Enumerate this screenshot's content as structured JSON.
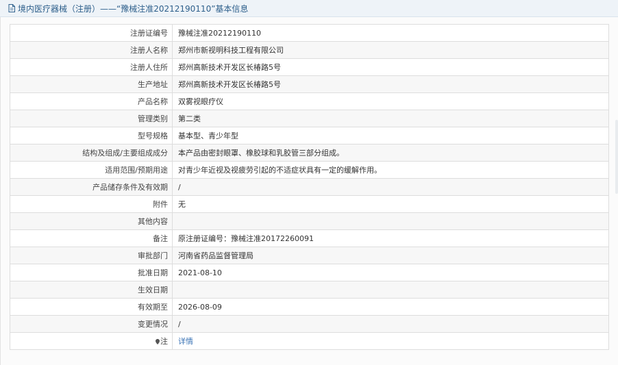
{
  "header": {
    "icon": "document-icon",
    "title": "境内医疗器械（注册）——“豫械注准20212190110”基本信息"
  },
  "rows": [
    {
      "label": "注册证编号",
      "value": "豫械注准20212190110"
    },
    {
      "label": "注册人名称",
      "value": "郑州市新视明科技工程有限公司"
    },
    {
      "label": "注册人住所",
      "value": "郑州高新技术开发区长椿路5号"
    },
    {
      "label": "生产地址",
      "value": "郑州高新技术开发区长椿路5号"
    },
    {
      "label": "产品名称",
      "value": "双雾视眼疗仪"
    },
    {
      "label": "管理类别",
      "value": "第二类"
    },
    {
      "label": "型号规格",
      "value": "基本型、青少年型"
    },
    {
      "label": "结构及组成/主要组成成分",
      "value": "本产品由密封眼罩、橡胶球和乳胶管三部分组成。"
    },
    {
      "label": "适用范围/预期用途",
      "value": "对青少年近视及视疲劳引起的不适症状具有一定的缓解作用。"
    },
    {
      "label": "产品储存条件及有效期",
      "value": "/"
    },
    {
      "label": "附件",
      "value": "无"
    },
    {
      "label": "其他内容",
      "value": ""
    },
    {
      "label": "备注",
      "value": "原注册证编号：豫械注准20172260091"
    },
    {
      "label": "审批部门",
      "value": "河南省药品监督管理局"
    },
    {
      "label": "批准日期",
      "value": "2021-08-10"
    },
    {
      "label": "生效日期",
      "value": ""
    },
    {
      "label": "有效期至",
      "value": "2026-08-09"
    },
    {
      "label": "变更情况",
      "value": "/"
    },
    {
      "label": "注",
      "value": "详情",
      "icon": "pin-icon"
    }
  ],
  "colors": {
    "header_bg": "#eef3f8",
    "header_text": "#2d5f8b",
    "link": "#3a73b5",
    "border": "#dddddd"
  }
}
